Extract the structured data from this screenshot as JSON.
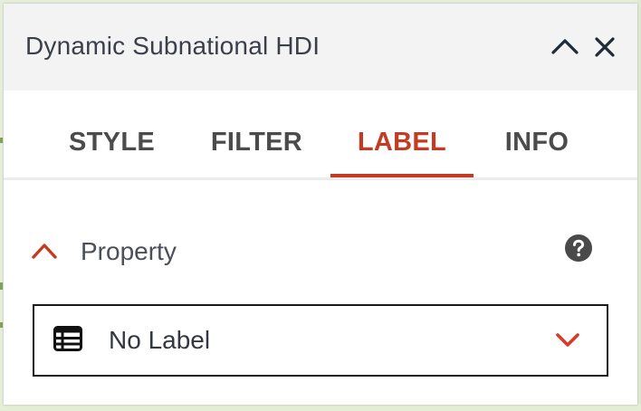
{
  "panel": {
    "title": "Dynamic Subnational HDI"
  },
  "tabs": [
    {
      "label": "STYLE",
      "active": false
    },
    {
      "label": "FILTER",
      "active": false
    },
    {
      "label": "LABEL",
      "active": true
    },
    {
      "label": "INFO",
      "active": false
    }
  ],
  "label_section": {
    "heading": "Property",
    "expanded": true,
    "select": {
      "value": "No Label"
    }
  },
  "icons": {
    "collapse": "chevron-up-icon",
    "close": "close-icon",
    "section_toggle": "chevron-up-icon",
    "help": "help-icon",
    "select_leading": "table-icon",
    "select_dropdown": "chevron-down-icon"
  },
  "colors": {
    "accent": "#c23b22",
    "header_bg": "#f3f3f3",
    "text": "#3a3f4a",
    "tab_text": "#4b4b4b"
  }
}
